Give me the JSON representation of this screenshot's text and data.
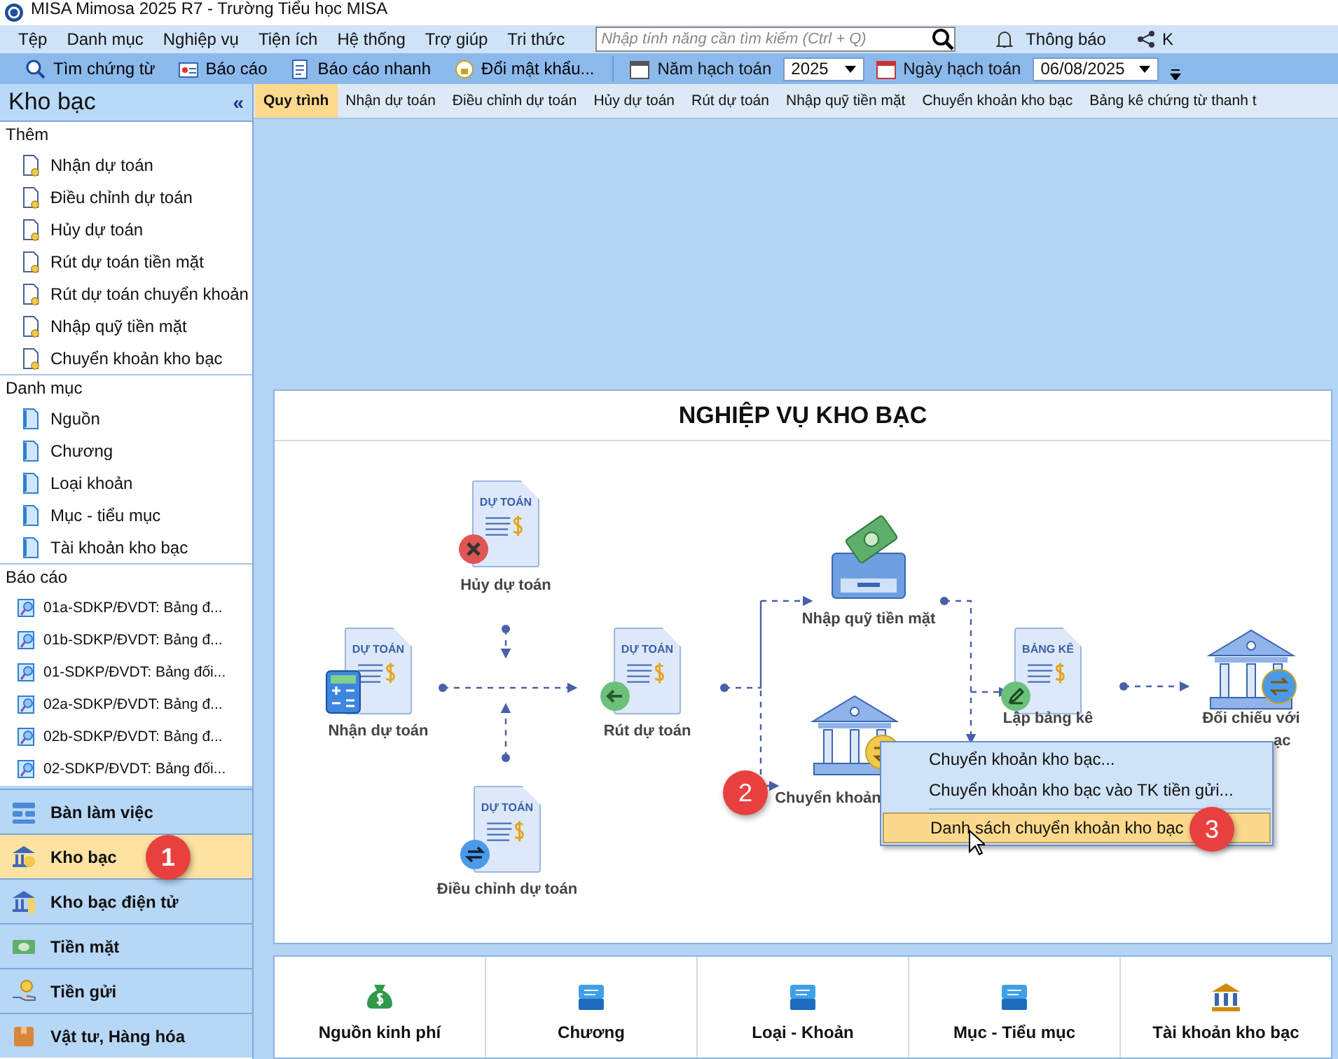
{
  "window": {
    "title": "MISA Mimosa 2025 R7 - Trường Tiểu học MISA"
  },
  "menu_bar": {
    "items": [
      "Tệp",
      "Danh mục",
      "Nghiệp vụ",
      "Tiện ích",
      "Hệ thống",
      "Trợ giúp",
      "Tri thức"
    ],
    "search": {
      "placeholder": "Nhập tính năng cần tìm kiếm (Ctrl + Q)"
    },
    "notification": "Thông báo",
    "extra": "K"
  },
  "toolbar": {
    "buttons": [
      {
        "label": "Tìm chứng từ",
        "kind": "search"
      },
      {
        "label": "Báo cáo",
        "kind": "report"
      },
      {
        "label": "Báo cáo nhanh",
        "kind": "quick-report"
      },
      {
        "label": "Đổi mật khẩu...",
        "kind": "password"
      }
    ],
    "year_label": "Năm hạch toán",
    "year": "2025",
    "date_label": "Ngày hạch toán",
    "date": "06/08/2025"
  },
  "sidebar": {
    "title": "Kho bạc",
    "collapse": "«",
    "sections": [
      {
        "title": "Thêm",
        "kind": "add",
        "items": [
          "Nhận dự toán",
          "Điều chỉnh dự toán",
          "Hủy dự toán",
          "Rút dự toán tiền mặt",
          "Rút dự toán chuyển khoản",
          "Nhập quỹ tiền mặt",
          "Chuyển khoản kho bạc"
        ]
      },
      {
        "title": "Danh mục",
        "kind": "catalog",
        "items": [
          "Nguồn",
          "Chương",
          "Loại khoản",
          "Mục - tiểu mục",
          "Tài khoản kho bạc"
        ]
      },
      {
        "title": "Báo cáo",
        "kind": "report",
        "items": [
          "01a-SDKP/ĐVDT:  Bảng đ...",
          "01b-SDKP/ĐVDT:  Bảng đ...",
          "01-SDKP/ĐVDT:  Bảng đối...",
          "02a-SDKP/ĐVDT:  Bảng đ...",
          "02b-SDKP/ĐVDT:  Bảng đ...",
          "02-SDKP/ĐVDT:  Bảng đối..."
        ]
      }
    ],
    "modules": [
      {
        "label": "Bàn làm việc",
        "kind": "desk",
        "selected": false
      },
      {
        "label": "Kho bạc",
        "kind": "bank",
        "selected": true
      },
      {
        "label": "Kho bạc điện tử",
        "kind": "ebank",
        "selected": false
      },
      {
        "label": "Tiền mặt",
        "kind": "cash",
        "selected": false
      },
      {
        "label": "Tiền gửi",
        "kind": "deposit",
        "selected": false
      },
      {
        "label": "Vật tư, Hàng hóa",
        "kind": "goods",
        "selected": false
      }
    ]
  },
  "tabs": [
    {
      "label": "Quy trình",
      "selected": true
    },
    {
      "label": "Nhận dự toán",
      "selected": false
    },
    {
      "label": "Điều chỉnh dự toán",
      "selected": false
    },
    {
      "label": "Hủy dự toán",
      "selected": false
    },
    {
      "label": "Rút dự toán",
      "selected": false
    },
    {
      "label": "Nhập quỹ tiền mặt",
      "selected": false
    },
    {
      "label": "Chuyển khoản kho bạc",
      "selected": false
    },
    {
      "label": "Bảng kê chứng từ thanh t",
      "selected": false
    }
  ],
  "diagram": {
    "title": "NGHIỆP VỤ KHO BẠC",
    "nodes": [
      {
        "label": "Hủy dự toán",
        "kind": "document",
        "doc_title": "DỰ TOÁN"
      },
      {
        "label": "Nhận dự toán",
        "kind": "document",
        "doc_title": "DỰ TOÁN"
      },
      {
        "label": "Rút dự toán",
        "kind": "document",
        "doc_title": "DỰ TOÁN"
      },
      {
        "label": "Điều chỉnh dự toán",
        "kind": "document",
        "doc_title": "DỰ TOÁN"
      },
      {
        "label": "Nhập quỹ tiền mặt",
        "kind": "tray"
      },
      {
        "label": "Chuyển khoản",
        "kind": "bank"
      },
      {
        "label": "Lập bảng kê",
        "kind": "document",
        "doc_title": "BẢNG KÊ"
      },
      {
        "label": "Đối chiếu với",
        "kind": "bank",
        "label_tail": "ạc"
      }
    ]
  },
  "context_menu": {
    "items": [
      {
        "label": "Chuyển khoản kho bạc...",
        "selected": false
      },
      {
        "label": "Chuyển khoản kho bạc vào TK tiền gửi...",
        "selected": false
      },
      {
        "label": "Danh sách chuyển khoản kho bạc",
        "selected": true
      }
    ]
  },
  "shortcuts": [
    {
      "label": "Nguồn kinh phí",
      "kind": "money-bag"
    },
    {
      "label": "Chương",
      "kind": "tray"
    },
    {
      "label": "Loại - Khoản",
      "kind": "tray"
    },
    {
      "label": "Mục - Tiểu mục",
      "kind": "tray"
    },
    {
      "label": "Tài khoản kho bạc",
      "kind": "bank"
    }
  ],
  "step_badges": [
    "1",
    "2",
    "3"
  ]
}
